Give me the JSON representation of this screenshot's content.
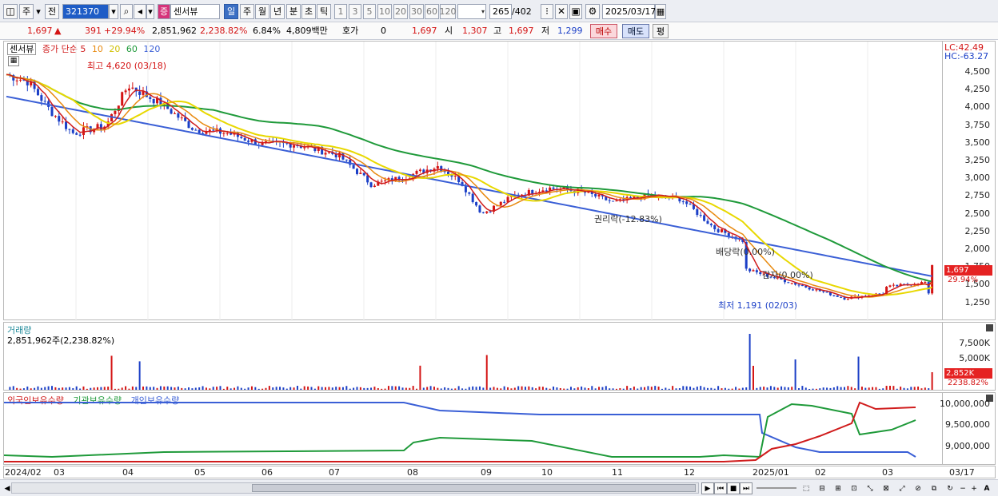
{
  "toolbar": {
    "mode_primary": "주",
    "mode_secondary": "전",
    "stock_code": "321370",
    "stock_badge": "증",
    "stock_name": "센서뷰",
    "periods": [
      "일",
      "주",
      "월",
      "년",
      "분",
      "초",
      "틱"
    ],
    "selected_period": "일",
    "intervals": [
      "1",
      "3",
      "5",
      "10",
      "20",
      "30",
      "60",
      "120"
    ],
    "count_value": "265",
    "count_total": "/402",
    "date_value": "2025/03/17"
  },
  "info": {
    "price": "1,697",
    "change": "391",
    "change_pct": "+29.94%",
    "volume": "2,851,962",
    "volume_pct": "2,238.82%",
    "turnover_pct": "6.84%",
    "amount": "4,809백만",
    "quote_label": "호가",
    "quote_value": "0",
    "quote_price": "1,697",
    "open_label": "시",
    "open": "1,307",
    "high_label": "고",
    "high": "1,697",
    "low_label": "저",
    "low": "1,299",
    "buy_label": "매수",
    "sell_label": "매도",
    "avg_label": "평"
  },
  "price_pane": {
    "stock_tag": "센서뷰",
    "legend_title": "종가 단순",
    "legend_items": [
      {
        "label": "5",
        "color": "#d01c1c"
      },
      {
        "label": "10",
        "color": "#e88a10"
      },
      {
        "label": "20",
        "color": "#e8d800"
      },
      {
        "label": "60",
        "color": "#1f9a3a"
      },
      {
        "label": "120",
        "color": "#3a5fd6"
      }
    ],
    "lc_text": "LC:42.49",
    "hc_text": "HC:-63.27",
    "high_annotation": "최고 4,620 (03/18)",
    "low_annotation": "최저 1,191 (02/03)",
    "event_rights": "권리락(-12.83%)",
    "event_dividend": "배당락(0.00%)",
    "event_reduction": "감자(0.00%)",
    "y_ticks": [
      "4,500",
      "4,250",
      "4,000",
      "3,750",
      "3,500",
      "3,250",
      "3,000",
      "2,750",
      "2,500",
      "2,250",
      "2,000",
      "1,750",
      "1,500",
      "1,250"
    ],
    "price_badge": "1,697",
    "pct_badge": "29.94%"
  },
  "volume_pane": {
    "title": "거래량",
    "subtitle": "2,851,962주(2,238.82%)",
    "y_ticks": [
      "7,500K",
      "5,000K",
      "2,500K"
    ],
    "vol_badge": "2,852K",
    "vol_pct": "2238.82%"
  },
  "holding_pane": {
    "legend": [
      {
        "label": "외국인보유수량",
        "color": "#d01c1c"
      },
      {
        "label": "기관보유수량",
        "color": "#1f9a3a"
      },
      {
        "label": "개인보유수량",
        "color": "#3a5fd6"
      }
    ],
    "y_ticks": [
      "10,000,000",
      "9,500,000",
      "9,000,000"
    ]
  },
  "x_axis": [
    "2024/02",
    "03",
    "04",
    "05",
    "06",
    "07",
    "08",
    "09",
    "10",
    "11",
    "12",
    "2025/01",
    "02",
    "03",
    "03/17"
  ],
  "colors": {
    "up": "#d41414",
    "down": "#1b3fc7",
    "ma5": "#d01c1c",
    "ma10": "#e88a10",
    "ma20": "#e8d800",
    "ma60": "#1f9a3a",
    "ma120": "#3a5fd6"
  }
}
